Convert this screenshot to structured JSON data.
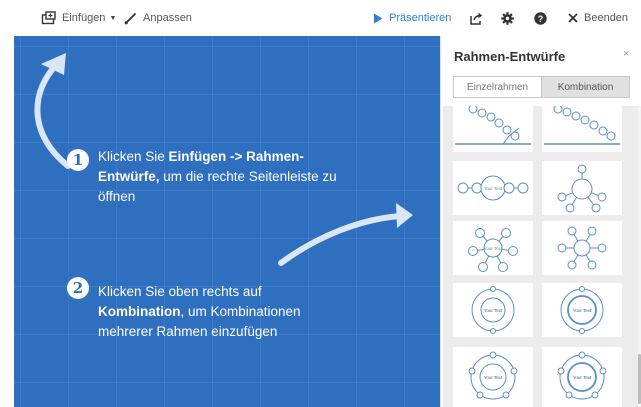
{
  "toolbar": {
    "insert_label": "Einfügen",
    "customize_label": "Anpassen",
    "present_label": "Präsentieren",
    "exit_label": "Beenden",
    "icons": {
      "insert": "frame-insert-icon",
      "customize": "brush-icon",
      "present": "play-icon",
      "share": "share-icon",
      "settings": "gear-icon",
      "help": "help-icon",
      "exit": "close-icon"
    },
    "accent_color": "#2b7fd9"
  },
  "canvas": {
    "background_color": "#2f6fc0",
    "step1": {
      "number": "1",
      "text_before": "Klicken Sie ",
      "bold": "Einfügen -> Rahmen-Entwürfe,",
      "text_after": " um die rechte Seitenleiste zu öffnen"
    },
    "step2": {
      "number": "2",
      "text_before": "Klicken Sie oben rechts auf ",
      "bold": "Kombination",
      "text_after": ", um Kombinationen mehrerer Rahmen einzufügen"
    }
  },
  "sidebar": {
    "title": "Rahmen-Entwürfe",
    "close_symbol": "×",
    "tabs": [
      {
        "label": "Einzelrahmen",
        "active": false
      },
      {
        "label": "Kombination",
        "active": true
      }
    ],
    "thumbnail_label": "Your Text"
  }
}
